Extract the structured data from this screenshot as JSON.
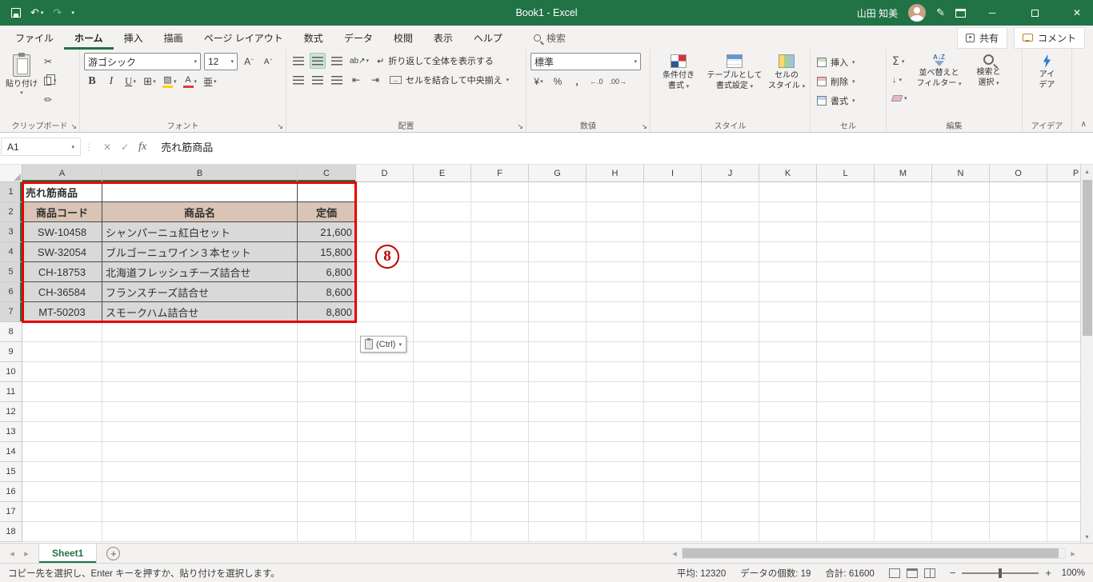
{
  "titlebar": {
    "title": "Book1 - Excel",
    "user": "山田 知美"
  },
  "tabrow": {
    "tabs": [
      {
        "name": "file",
        "label": "ファイル"
      },
      {
        "name": "home",
        "label": "ホーム",
        "active": true
      },
      {
        "name": "insert",
        "label": "挿入"
      },
      {
        "name": "draw",
        "label": "描画"
      },
      {
        "name": "page-layout",
        "label": "ページ レイアウト"
      },
      {
        "name": "formulas",
        "label": "数式"
      },
      {
        "name": "data",
        "label": "データ"
      },
      {
        "name": "review",
        "label": "校閲"
      },
      {
        "name": "view",
        "label": "表示"
      },
      {
        "name": "help",
        "label": "ヘルプ"
      }
    ],
    "search": "検索",
    "share": "共有",
    "comment": "コメント"
  },
  "ribbon": {
    "paste": "貼り付け",
    "font_name": "游ゴシック",
    "font_size": "12",
    "wrap_text": "折り返して全体を表示する",
    "merge_center": "セルを結合して中央揃え",
    "number_format": "標準",
    "cond1": "条件付き",
    "cond2": "書式",
    "tablefmt1": "テーブルとして",
    "tablefmt2": "書式設定",
    "cellstyle1": "セルの",
    "cellstyle2": "スタイル",
    "insert": "挿入",
    "delete": "削除",
    "format": "書式",
    "sort1": "並べ替えと",
    "sort2": "フィルター",
    "find1": "検索と",
    "find2": "選択",
    "ideas1": "アイ",
    "ideas2": "デア",
    "groups": {
      "clipboard": "クリップボード",
      "font": "フォント",
      "alignment": "配置",
      "number": "数値",
      "styles": "スタイル",
      "cells": "セル",
      "editing": "編集",
      "ideas": "アイデア"
    }
  },
  "formula": {
    "name_box": "A1",
    "content": "売れ筋商品"
  },
  "sheet": {
    "columns": [
      "A",
      "B",
      "C",
      "D",
      "E",
      "F",
      "G",
      "H",
      "I",
      "J",
      "K",
      "L",
      "M",
      "N",
      "O",
      "P"
    ],
    "visible_rows": 18,
    "selected_columns": [
      "A",
      "B",
      "C"
    ],
    "selected_row_count": 7,
    "title_cell": "売れ筋商品",
    "table_headers": [
      "商品コード",
      "商品名",
      "定価"
    ],
    "table_rows": [
      [
        "SW-10458",
        "シャンパーニュ紅白セット",
        "21,600"
      ],
      [
        "SW-32054",
        "ブルゴーニュワイン３本セット",
        "15,800"
      ],
      [
        "CH-18753",
        "北海道フレッシュチーズ詰合せ",
        "6,800"
      ],
      [
        "CH-36584",
        "フランスチーズ詰合せ",
        "8,600"
      ],
      [
        "MT-50203",
        "スモークハム詰合せ",
        "8,800"
      ]
    ],
    "annotation": "8",
    "paste_options": "(Ctrl)"
  },
  "sheet_tabs": {
    "active": "Sheet1"
  },
  "status": {
    "message": "コピー先を選択し、Enter キーを押すか、貼り付けを選択します。",
    "stats": [
      {
        "name": "average",
        "text": "平均: 12320"
      },
      {
        "name": "count",
        "text": "データの個数: 19"
      },
      {
        "name": "sum",
        "text": "合計: 61600"
      }
    ],
    "zoom": "100%"
  },
  "colors": {
    "excel_green": "#217346",
    "table_header_bg": "#d9c4b5",
    "table_row_bg": "#d9d9d9",
    "highlight_red": "#e60000",
    "comment_orange": "#c47f1d"
  }
}
